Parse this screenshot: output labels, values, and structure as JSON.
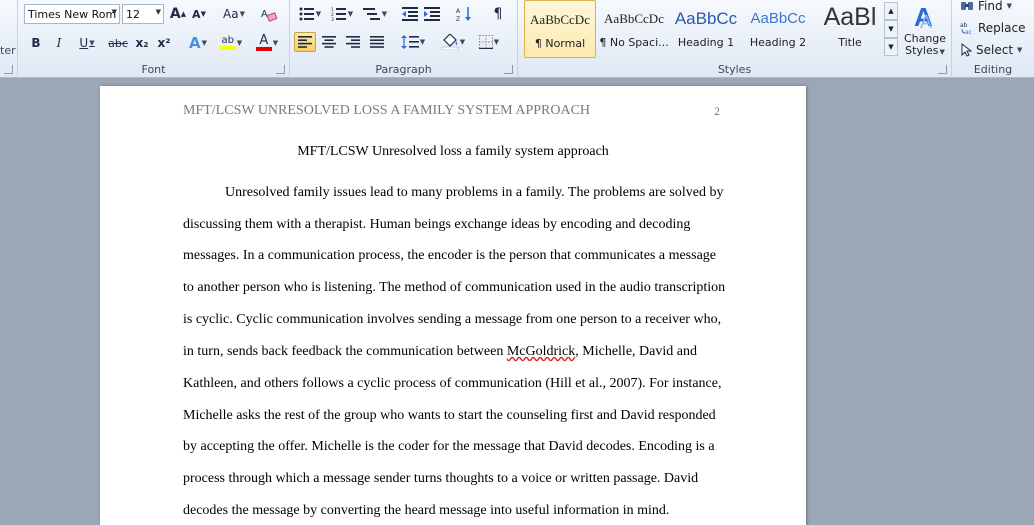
{
  "ribbon": {
    "left_stub": "ter",
    "font": {
      "label": "Font",
      "font_name": "Times New Rom",
      "font_size": "12",
      "grow": "A",
      "shrink": "A",
      "change_case": "Aa",
      "bold": "B",
      "italic": "I",
      "underline": "U",
      "strike": "abc",
      "subscript": "x₂",
      "superscript": "x²",
      "effects": "A",
      "highlight": "ab",
      "color": "A"
    },
    "paragraph": {
      "label": "Paragraph",
      "pilcrow": "¶"
    },
    "styles": {
      "label": "Styles",
      "tiles": [
        {
          "preview": "AaBbCcDc",
          "name": "¶ Normal"
        },
        {
          "preview": "AaBbCcDc",
          "name": "¶ No Spaci..."
        },
        {
          "preview": "AaBbCc",
          "name": "Heading 1"
        },
        {
          "preview": "AaBbCc",
          "name": "Heading 2"
        },
        {
          "preview": "AaBl",
          "name": "Title"
        }
      ],
      "change_styles_line1": "Change",
      "change_styles_line2": "Styles"
    },
    "editing": {
      "label": "Editing",
      "find": "Find",
      "replace": "Replace",
      "select": "Select"
    },
    "colors": {
      "highlight": "#ffff00",
      "font_color": "#e00000",
      "accent": "#2a6ad8"
    }
  },
  "document": {
    "header_text": "MFT/LCSW UNRESOLVED LOSS A FAMILY SYSTEM APPROACH",
    "page_number": "2",
    "title": "MFT/LCSW Unresolved loss a family system approach",
    "lines": [
      "Unresolved family issues lead to many problems in a family. The problems are solved by",
      "discussing them with a therapist. Human beings exchange ideas by encoding and decoding",
      "messages. In a communication process, the encoder is the person that communicates a message",
      "to another person who is listening.  The method of communication used in the audio transcription",
      "is cyclic. Cyclic communication involves sending a message from one person to a receiver who,",
      "Kathleen, and others follows a cyclic process of communication (Hill et al., 2007).  For instance,",
      "Michelle asks the rest of the group who wants to start the counseling first and David responded",
      "by accepting the offer. Michelle is the coder for the message that David decodes. Encoding is a",
      "process through which a message sender turns thoughts to a voice or written passage.  David",
      "decodes the message by converting the heard message into useful information in mind."
    ],
    "line6_pre": "in turn, sends back feedback the communication between ",
    "line6_misspelled": "McGoldrick",
    "line6_post": ", Michelle, David and"
  }
}
